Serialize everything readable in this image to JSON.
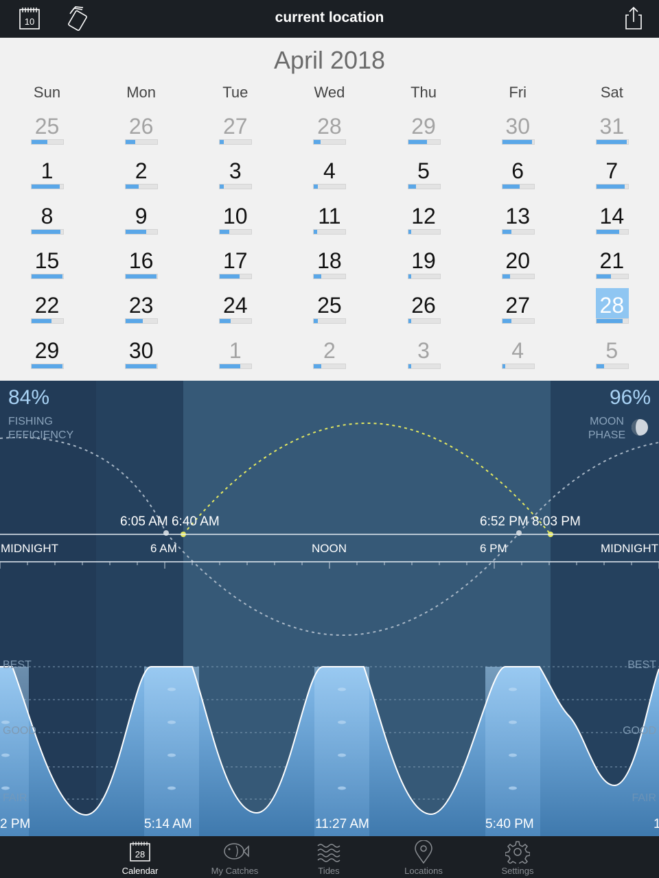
{
  "header": {
    "title": "current location",
    "calendar_icon_label": "10"
  },
  "calendar": {
    "month_title": "April 2018",
    "weekdays": [
      "Sun",
      "Mon",
      "Tue",
      "Wed",
      "Thu",
      "Fri",
      "Sat"
    ],
    "weeks": [
      [
        {
          "d": "25",
          "f": 0.5,
          "o": true
        },
        {
          "d": "26",
          "f": 0.3,
          "o": true
        },
        {
          "d": "27",
          "f": 0.12,
          "o": true
        },
        {
          "d": "28",
          "f": 0.2,
          "o": true
        },
        {
          "d": "29",
          "f": 0.6,
          "o": true
        },
        {
          "d": "30",
          "f": 0.95,
          "o": true
        },
        {
          "d": "31",
          "f": 0.95,
          "o": true
        }
      ],
      [
        {
          "d": "1",
          "f": 0.9
        },
        {
          "d": "2",
          "f": 0.4
        },
        {
          "d": "3",
          "f": 0.12
        },
        {
          "d": "4",
          "f": 0.12
        },
        {
          "d": "5",
          "f": 0.25
        },
        {
          "d": "6",
          "f": 0.55
        },
        {
          "d": "7",
          "f": 0.9
        }
      ],
      [
        {
          "d": "8",
          "f": 0.92
        },
        {
          "d": "9",
          "f": 0.65
        },
        {
          "d": "10",
          "f": 0.3
        },
        {
          "d": "11",
          "f": 0.1
        },
        {
          "d": "12",
          "f": 0.1
        },
        {
          "d": "13",
          "f": 0.3
        },
        {
          "d": "14",
          "f": 0.72
        }
      ],
      [
        {
          "d": "15",
          "f": 0.98
        },
        {
          "d": "16",
          "f": 0.98
        },
        {
          "d": "17",
          "f": 0.62
        },
        {
          "d": "18",
          "f": 0.22
        },
        {
          "d": "19",
          "f": 0.1
        },
        {
          "d": "20",
          "f": 0.25
        },
        {
          "d": "21",
          "f": 0.45
        }
      ],
      [
        {
          "d": "22",
          "f": 0.62
        },
        {
          "d": "23",
          "f": 0.55
        },
        {
          "d": "24",
          "f": 0.35
        },
        {
          "d": "25",
          "f": 0.12
        },
        {
          "d": "26",
          "f": 0.1
        },
        {
          "d": "27",
          "f": 0.3
        },
        {
          "d": "28",
          "f": 0.84,
          "sel": true
        }
      ],
      [
        {
          "d": "29",
          "f": 0.98
        },
        {
          "d": "30",
          "f": 0.98
        },
        {
          "d": "1",
          "f": 0.65,
          "o": true
        },
        {
          "d": "2",
          "f": 0.22,
          "o": true
        },
        {
          "d": "3",
          "f": 0.1,
          "o": true
        },
        {
          "d": "4",
          "f": 0.1,
          "o": true
        },
        {
          "d": "5",
          "f": 0.25,
          "o": true
        }
      ]
    ]
  },
  "chart": {
    "fishing_efficiency_value": "84%",
    "fishing_efficiency_label_1": "FISHING",
    "fishing_efficiency_label_2": "EFFICIENCY",
    "moon_phase_value": "96%",
    "moon_phase_label_1": "MOON",
    "moon_phase_label_2": "PHASE",
    "times_left": "6:05 AM 6:40 AM",
    "times_right": "6:52 PM 8:03 PM",
    "axis_labels": [
      "MIDNIGHT",
      "6 AM",
      "NOON",
      "6 PM",
      "MIDNIGHT"
    ],
    "levels": {
      "best": "BEST",
      "good": "GOOD",
      "fair": "FAIR"
    },
    "peak_times": [
      "2 PM",
      "5:14 AM",
      "11:27 AM",
      "5:40 PM",
      "1"
    ],
    "colors": {
      "night": "#25415e",
      "day": "#365977",
      "curve_fill": "#7eb6e6",
      "sun_path": "#e4e860",
      "moon_path": "#a8b7c6"
    }
  },
  "tabs": [
    {
      "label": "Calendar",
      "icon": "calendar-icon",
      "active": true,
      "icon_text": "28"
    },
    {
      "label": "My Catches",
      "icon": "fish-icon"
    },
    {
      "label": "Tides",
      "icon": "waves-icon"
    },
    {
      "label": "Locations",
      "icon": "location-pin-icon"
    },
    {
      "label": "Settings",
      "icon": "gear-icon"
    }
  ]
}
